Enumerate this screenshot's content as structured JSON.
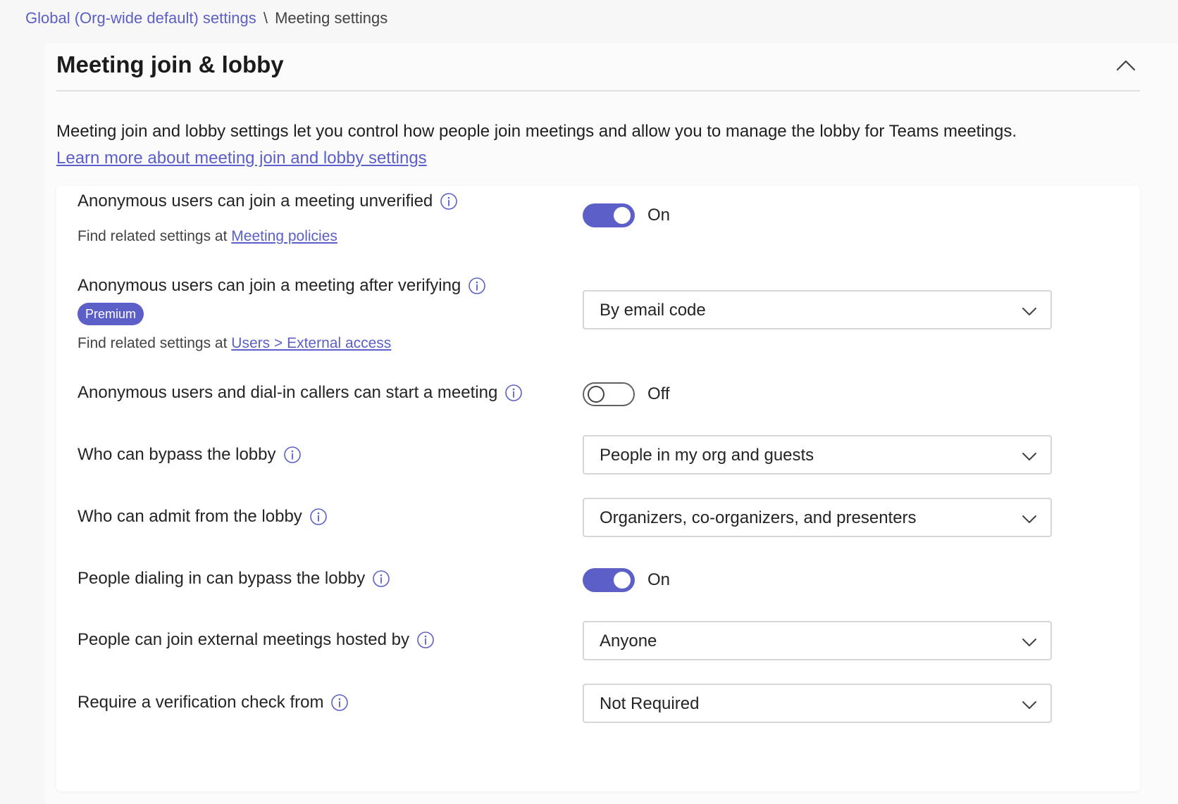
{
  "breadcrumb": {
    "parent": "Global (Org-wide default) settings",
    "separator": "\\",
    "current": "Meeting settings"
  },
  "section": {
    "title": "Meeting join & lobby",
    "description": "Meeting join and lobby settings let you control how people join meetings and allow you to manage the lobby for Teams meetings.",
    "learn_more": "Learn more about meeting join and lobby settings"
  },
  "settings": {
    "anonymous_unverified": {
      "label": "Anonymous users can join a meeting unverified",
      "related_prefix": "Find related settings at",
      "related_link": "Meeting policies",
      "state": "On"
    },
    "anonymous_verifying": {
      "label": "Anonymous users can join a meeting after verifying",
      "badge": "Premium",
      "related_prefix": "Find related settings at",
      "related_link": "Users > External access",
      "value": "By email code"
    },
    "anonymous_start": {
      "label": "Anonymous users and dial-in callers can start a meeting",
      "state": "Off"
    },
    "bypass_lobby": {
      "label": "Who can bypass the lobby",
      "value": "People in my org and guests"
    },
    "admit_lobby": {
      "label": "Who can admit from the lobby",
      "value": "Organizers, co-organizers, and presenters"
    },
    "dialin_bypass": {
      "label": "People dialing in can bypass the lobby",
      "state": "On"
    },
    "external_meetings": {
      "label": "People can join external meetings hosted by",
      "value": "Anyone"
    },
    "verification_check": {
      "label": "Require a verification check from",
      "value": "Not Required"
    }
  },
  "icons": {
    "info": "info-icon",
    "chevron_down": "chevron-down-icon",
    "chevron_up": "chevron-up-icon"
  },
  "colors": {
    "accent": "#5b5fc7",
    "text": "#242424",
    "background": "#f7f7f8"
  }
}
